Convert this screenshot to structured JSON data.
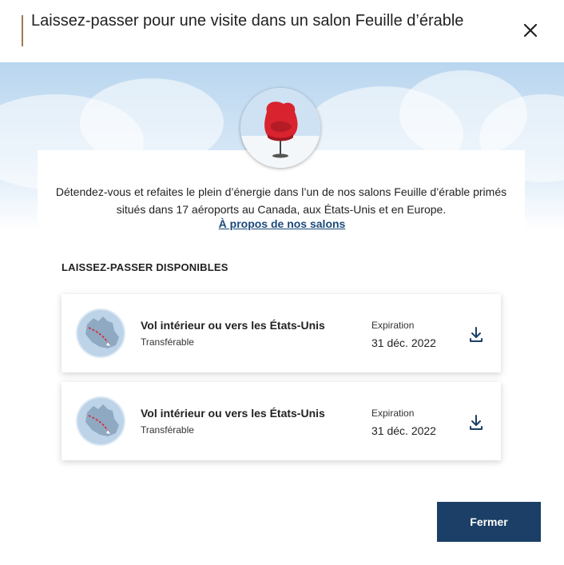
{
  "modal": {
    "title": "Laissez-passer pour une visite dans un salon Feuille d’érable",
    "close_icon": "close-icon",
    "intro": "Détendez-vous et refaites le plein d’énergie dans l’un de nos salons Feuille d’érable primés situés dans 17 aéroports au Canada, aux États-Unis et en Europe.",
    "about_link": "À propos de nos salons",
    "section_title": "LAISSEZ-PASSER DISPONIBLES",
    "passes": [
      {
        "name": "Vol intérieur ou vers les États-Unis",
        "subtitle": "Transférable",
        "expiration_label": "Expiration",
        "expiration_date": "31 déc. 2022",
        "icon": "canada-map-icon"
      },
      {
        "name": "Vol intérieur ou vers les États-Unis",
        "subtitle": "Transférable",
        "expiration_label": "Expiration",
        "expiration_date": "31 déc. 2022",
        "icon": "canada-map-icon"
      }
    ],
    "close_button": "Fermer"
  },
  "colors": {
    "accent_bar": "#9c7b4e",
    "link": "#1a4a7a",
    "primary_button": "#1b3f66",
    "chair_red": "#d9232e"
  }
}
